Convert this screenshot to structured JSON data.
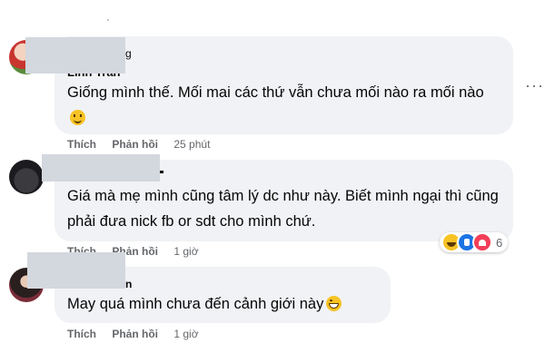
{
  "comments": [
    {
      "name": "Linh Trần",
      "name_tail": "g",
      "text": "Giống mình thế. Mối mai các thứ vẫn chưa mối nào ra mối nào",
      "emoji": "slightly-smiling-face",
      "time": "25 phút"
    },
    {
      "text": "Giá mà mẹ mình cũng tâm lý dc như này. Biết mình ngại thì cũng phải đưa nick fb or sdt cho mình chứ.",
      "time": "1 giờ",
      "reactions": {
        "icons": [
          "haha-icon",
          "like-icon",
          "love-icon"
        ],
        "count": "6"
      }
    },
    {
      "name_tail": "n",
      "text": "May quá mình chưa đến cảnh giới này",
      "emoji": "grinning-face",
      "time": "1 giờ"
    }
  ],
  "actions": {
    "like": "Thích",
    "reply": "Phản hồi"
  },
  "more_label": "···",
  "colors": {
    "bubble": "#f0f2f5",
    "meta": "#65676b",
    "text": "#050505",
    "censor": "#d3d7de"
  }
}
